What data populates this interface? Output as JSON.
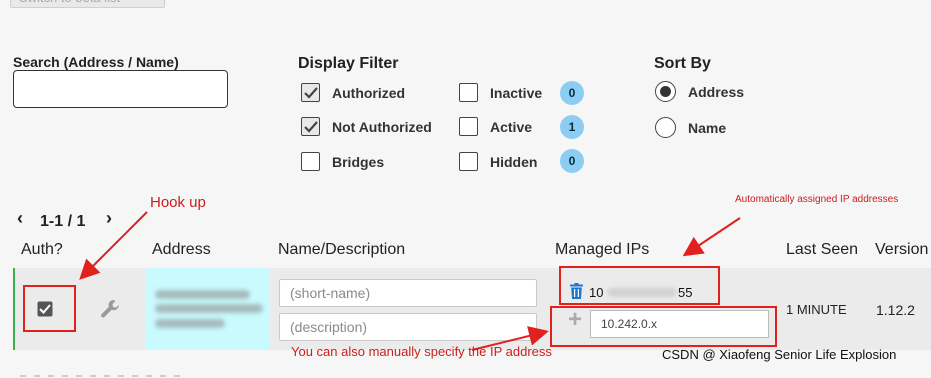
{
  "top_button": {
    "label": "Switch to beta list"
  },
  "search": {
    "label": "Search (Address / Name)",
    "value": "",
    "placeholder": ""
  },
  "display_filter": {
    "title": "Display Filter",
    "authorized": {
      "label": "Authorized",
      "checked": true
    },
    "not_authorized": {
      "label": "Not Authorized",
      "checked": true
    },
    "bridges": {
      "label": "Bridges",
      "checked": false
    },
    "inactive": {
      "label": "Inactive",
      "checked": false,
      "count": "0"
    },
    "active": {
      "label": "Active",
      "checked": false,
      "count": "1"
    },
    "hidden": {
      "label": "Hidden",
      "checked": false,
      "count": "0"
    }
  },
  "sort_by": {
    "title": "Sort By",
    "options": [
      {
        "label": "Address",
        "selected": true
      },
      {
        "label": "Name",
        "selected": false
      }
    ]
  },
  "pagination": {
    "prev": "‹",
    "range": "1-1 / 1",
    "next": "›"
  },
  "table": {
    "headers": {
      "auth": "Auth?",
      "address": "Address",
      "name": "Name/Description",
      "managed_ips": "Managed IPs",
      "last_seen": "Last Seen",
      "version": "Version"
    },
    "row": {
      "authorized": true,
      "name_placeholder": "(short-name)",
      "description_placeholder": "(description)",
      "managed_ip_start": "10",
      "managed_ip_end": "55",
      "add_ip_icon": "+",
      "new_ip_value": "10.242.0.x",
      "last_seen": "1 MINUTE",
      "version": "1.12.2"
    }
  },
  "annotations": {
    "hook_up": "Hook up",
    "auto_ip": "Automatically assigned IP addresses",
    "manual_ip": "You can also manually specify the IP address",
    "watermark": "CSDN @ Xiaofeng Senior Life Explosion",
    "color": "#e0211e"
  },
  "colors": {
    "badge": "#8ccdf3",
    "address_cell": "#c9fafd",
    "trash": "#1f77d0",
    "row_accent": "#3bb04a"
  }
}
